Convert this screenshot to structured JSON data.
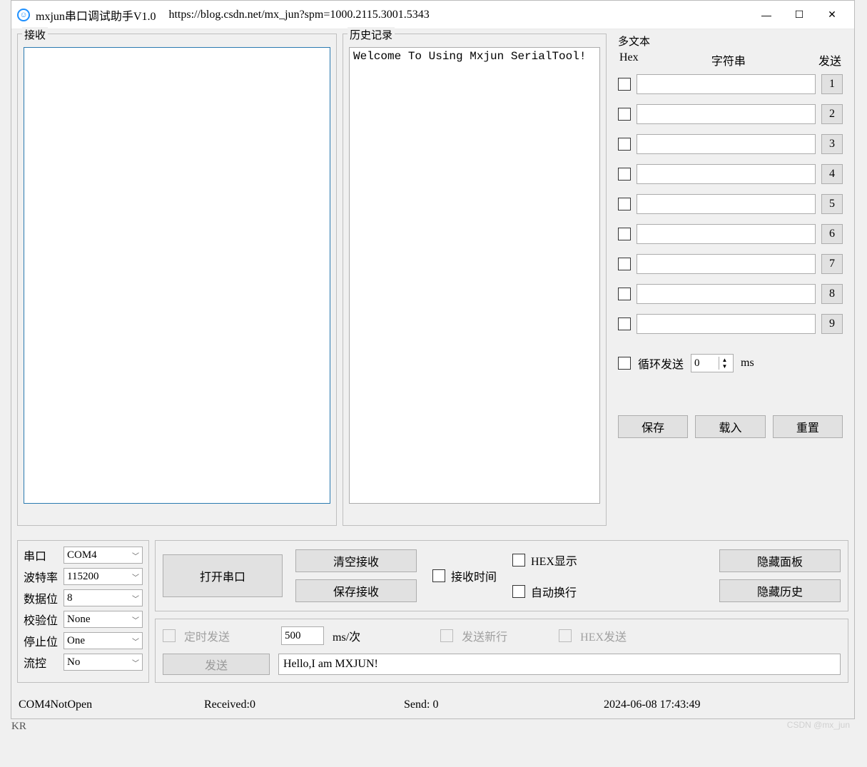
{
  "titlebar": {
    "title": "mxjun串口调试助手V1.0",
    "url": "https://blog.csdn.net/mx_jun?spm=1000.2115.3001.5343"
  },
  "receive": {
    "title": "接收",
    "content": ""
  },
  "history": {
    "title": "历史记录",
    "content": "Welcome To Using Mxjun SerialTool!"
  },
  "multi": {
    "title": "多文本",
    "hdr_hex": "Hex",
    "hdr_str": "字符串",
    "hdr_send": "发送",
    "rows": [
      {
        "n": "1",
        "v": ""
      },
      {
        "n": "2",
        "v": ""
      },
      {
        "n": "3",
        "v": ""
      },
      {
        "n": "4",
        "v": ""
      },
      {
        "n": "5",
        "v": ""
      },
      {
        "n": "6",
        "v": ""
      },
      {
        "n": "7",
        "v": ""
      },
      {
        "n": "8",
        "v": ""
      },
      {
        "n": "9",
        "v": ""
      }
    ],
    "loop_label": "循环发送",
    "loop_value": "0",
    "loop_unit": "ms",
    "btn_save": "保存",
    "btn_load": "载入",
    "btn_reset": "重置"
  },
  "port": {
    "l_port": "串口",
    "v_port": "COM4",
    "l_baud": "波特率",
    "v_baud": "115200",
    "l_data": "数据位",
    "v_data": "8",
    "l_parity": "校验位",
    "v_parity": "None",
    "l_stop": "停止位",
    "v_stop": "One",
    "l_flow": "流控",
    "v_flow": "No"
  },
  "ctrl": {
    "open": "打开串口",
    "clear_recv": "清空接收",
    "save_recv": "保存接收",
    "recv_time": "接收时间",
    "hex_show": "HEX显示",
    "auto_wrap": "自动换行",
    "hide_panel": "隐藏面板",
    "hide_history": "隐藏历史"
  },
  "send": {
    "timed_label": "定时发送",
    "interval": "500",
    "interval_unit": "ms/次",
    "newline": "发送新行",
    "hex_send": "HEX发送",
    "send_btn": "发送",
    "send_text": "Hello,I am MXJUN!"
  },
  "status": {
    "port": "COM4NotOpen",
    "recv": "Received:0",
    "send": "Send: 0",
    "time": "2024-06-08  17:43:49"
  },
  "watermark": "CSDN @mx_jun",
  "below": "KR"
}
